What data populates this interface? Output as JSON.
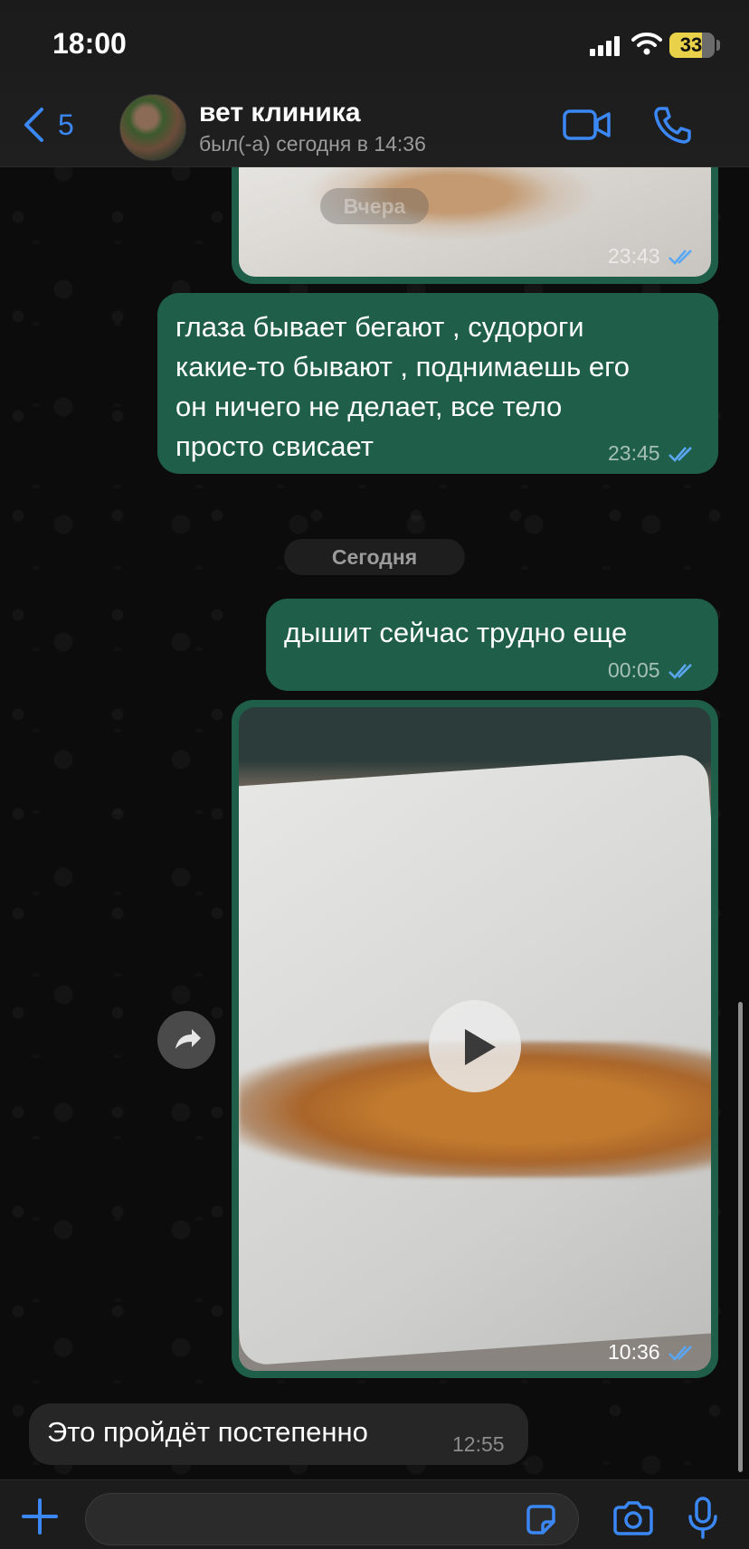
{
  "status_bar": {
    "time": "18:00",
    "battery": "33"
  },
  "header": {
    "back_count": "5",
    "contact_name": "вет клиника",
    "contact_status": "был(-а) сегодня в 14:36"
  },
  "messages": [
    {
      "type": "photo",
      "direction": "outgoing",
      "overlay_date": "Вчера",
      "time": "23:43",
      "read": true
    },
    {
      "type": "text",
      "direction": "outgoing",
      "lines": [
        "глаза бывает бегают , судороги",
        "какие-то бывают , поднимаешь его",
        "он ничего не делает, все тело",
        "просто свисает"
      ],
      "time": "23:45",
      "read": true
    },
    {
      "type": "date",
      "label": "Сегодня"
    },
    {
      "type": "text",
      "direction": "outgoing",
      "lines": [
        "дышит сейчас трудно еще"
      ],
      "time": "00:05",
      "read": true
    },
    {
      "type": "video",
      "direction": "outgoing",
      "time": "10:36",
      "read": true
    },
    {
      "type": "text",
      "direction": "incoming",
      "lines": [
        "Это пройдёт постепенно"
      ],
      "time": "12:55"
    }
  ],
  "composer": {
    "placeholder": ""
  },
  "colors": {
    "accent": "#3b88f5",
    "outgoing_bubble": "#1f5f4a",
    "incoming_bubble": "#262626",
    "read_check": "#5aa7f5"
  },
  "icons": [
    "back-chevron-icon",
    "video-call-icon",
    "phone-icon",
    "forward-icon",
    "play-icon",
    "plus-icon",
    "sticker-icon",
    "camera-icon",
    "microphone-icon"
  ]
}
